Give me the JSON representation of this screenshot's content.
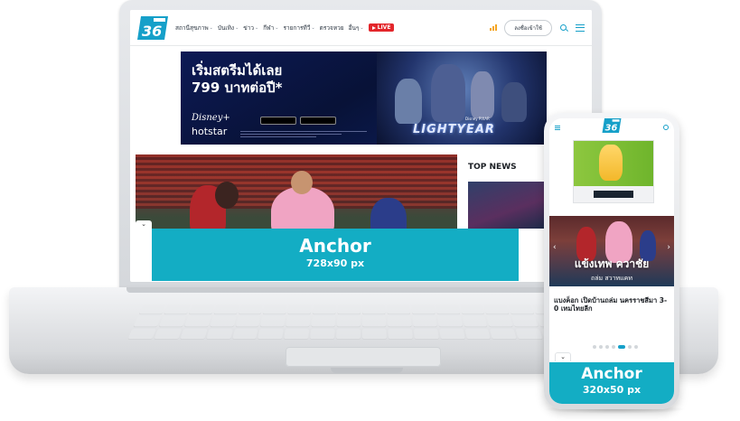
{
  "site": {
    "nav_items": [
      "สถานีสุขภาพ",
      "บันเทิง",
      "ข่าว",
      "กีฬา",
      "รายการทีวี",
      "ตรวจหวย",
      "อื่นๆ"
    ],
    "live_label": "LIVE",
    "login_label": "ลงชื่อเข้าใช้"
  },
  "banner": {
    "headline_line1": "เริ่มสตรีมได้เลย",
    "headline_line2": "799 บาทต่อปี*",
    "brand": "Disney+",
    "brand_sub": "hotstar",
    "movie_title": "LIGHTYEAR",
    "studio": "Disney PIXAR"
  },
  "top_news": {
    "title": "TOP NEWS"
  },
  "anchor_desktop": {
    "title": "Anchor",
    "size": "728x90 px"
  },
  "phone": {
    "hero_title": "แข้งเทพ ควาชัย",
    "hero_subtitle": "ถล่ม สวาทแคท",
    "headline": "แบงค็อก เปิดบ้านถล่ม นครราชสีมา 3-0 เทมไทยลีก",
    "anchor_title": "Anchor",
    "anchor_size": "320x50 px"
  },
  "colors": {
    "brand_cyan": "#13adc4",
    "live_red": "#e3262b",
    "banner_navy": "#0a1541"
  }
}
